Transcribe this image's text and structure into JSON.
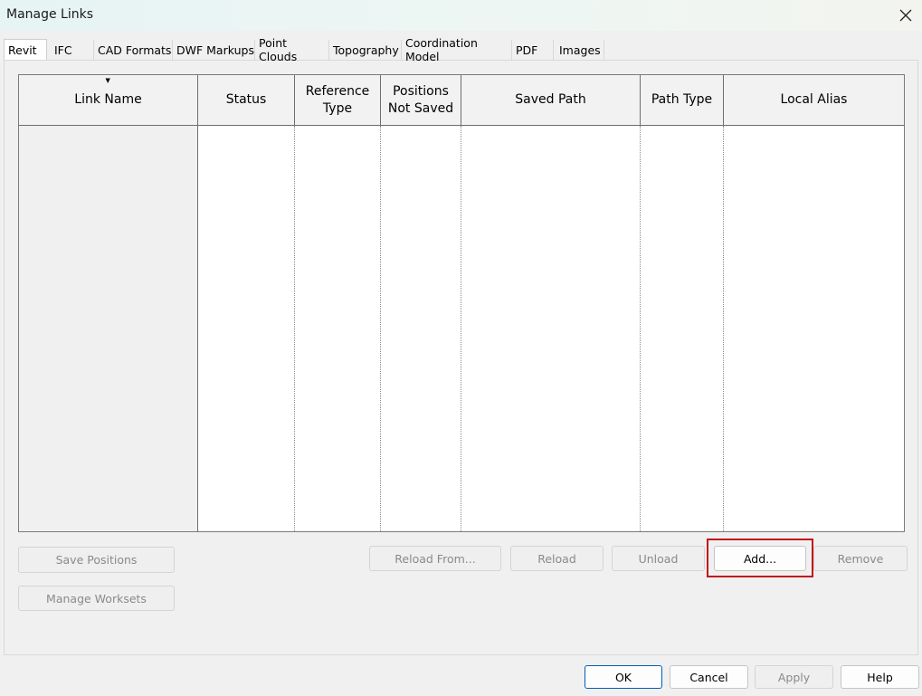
{
  "window": {
    "title": "Manage Links",
    "close_icon": "close-icon"
  },
  "tabs": [
    {
      "label": "Revit",
      "active": true
    },
    {
      "label": "IFC",
      "active": false
    },
    {
      "label": "CAD Formats",
      "active": false
    },
    {
      "label": "DWF Markups",
      "active": false
    },
    {
      "label": "Point Clouds",
      "active": false
    },
    {
      "label": "Topography",
      "active": false
    },
    {
      "label": "Coordination Model",
      "active": false
    },
    {
      "label": "PDF",
      "active": false
    },
    {
      "label": "Images",
      "active": false
    }
  ],
  "grid": {
    "sort_icon": "sort-descending-icon",
    "columns": [
      {
        "l1": "Link Name",
        "l2": ""
      },
      {
        "l1": "Status",
        "l2": ""
      },
      {
        "l1": "Reference",
        "l2": "Type"
      },
      {
        "l1": "Positions",
        "l2": "Not Saved"
      },
      {
        "l1": "Saved Path",
        "l2": ""
      },
      {
        "l1": "Path Type",
        "l2": ""
      },
      {
        "l1": "Local Alias",
        "l2": ""
      }
    ],
    "rows": []
  },
  "buttons": {
    "save_positions": "Save Positions",
    "manage_worksets": "Manage Worksets",
    "reload_from": "Reload From...",
    "reload": "Reload",
    "unload": "Unload",
    "add": "Add...",
    "remove": "Remove",
    "ok": "OK",
    "cancel": "Cancel",
    "apply": "Apply",
    "help": "Help"
  },
  "colors": {
    "highlight": "#c0141c",
    "primary_border": "#005fb8"
  }
}
